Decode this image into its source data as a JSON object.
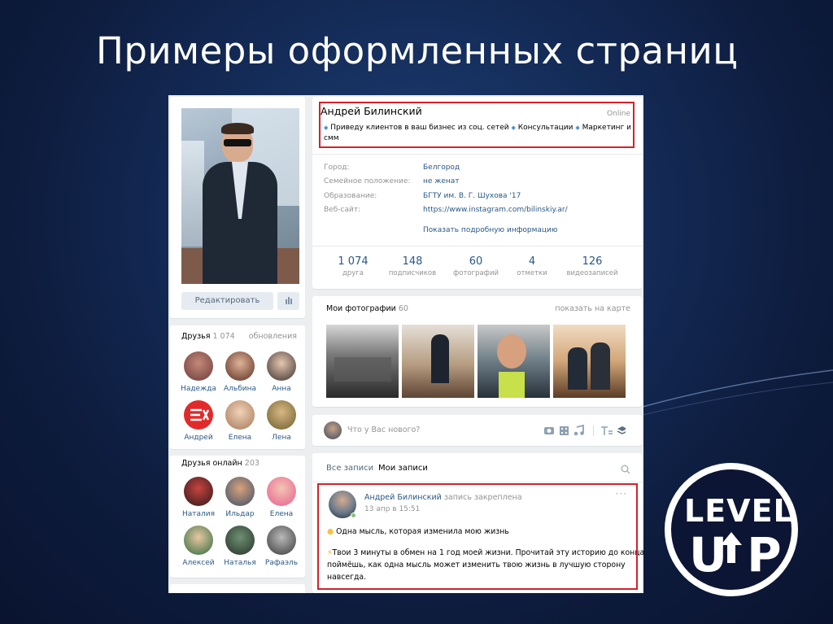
{
  "slide": {
    "title": "Примеры оформленных страниц"
  },
  "profile": {
    "name": "Андрей Билинский",
    "online": "Online",
    "status_line1": "Приведу клиентов в ваш бизнес из соц. сетей",
    "status_item2": "Консультации",
    "status_item3": "Маркетинг и",
    "status_line2": "смм",
    "info": [
      {
        "label": "Город:",
        "value": "Белгород"
      },
      {
        "label": "Семейное положение:",
        "value": "не женат"
      },
      {
        "label": "Образование:",
        "value": "БГТУ им. В. Г. Шухова '17"
      },
      {
        "label": "Веб-сайт:",
        "value": "https://www.instagram.com/bilinskiy.ar/"
      }
    ],
    "show_more": "Показать подробную информацию",
    "stats": [
      {
        "n": "1 074",
        "l": "друга"
      },
      {
        "n": "148",
        "l": "подписчиков"
      },
      {
        "n": "60",
        "l": "фотографий"
      },
      {
        "n": "4",
        "l": "отметки"
      },
      {
        "n": "126",
        "l": "видеозаписей"
      }
    ],
    "edit_button": "Редактировать"
  },
  "friends": {
    "title": "Друзья",
    "count": "1 074",
    "updates": "обновления",
    "items": [
      "Надежда",
      "Альбина",
      "Анна",
      "Андрей",
      "Елена",
      "Лена"
    ]
  },
  "friends_online": {
    "title": "Друзья онлайн",
    "count": "203",
    "items": [
      "Наталия",
      "Ильдар",
      "Елена",
      "Алексей",
      "Наталья",
      "Рафаэль"
    ]
  },
  "photos": {
    "title": "Мои фотографии",
    "count": "60",
    "map_link": "показать на карте"
  },
  "composer": {
    "placeholder": "Что у Вас нового?"
  },
  "wall": {
    "tab_all": "Все записи",
    "tab_mine": "Мои записи",
    "post": {
      "author": "Андрей Билинский",
      "pinned": "запись закреплена",
      "date": "13 апр в 15:51",
      "line1": "Одна мысль, которая изменила мою жизнь",
      "line2": "Твои 3 минуты в обмен на 1 год моей жизни. Прочитай эту историю до конца и",
      "line3": "поймёшь, как одна мысль может изменить твою жизнь в лучшую сторону",
      "line4": "навсегда."
    }
  },
  "logo": {
    "line1": "LEVEL",
    "line2": "UP"
  },
  "colors": {
    "link": "#2a5885",
    "highlight": "#d4222a",
    "background": "#142b57"
  }
}
